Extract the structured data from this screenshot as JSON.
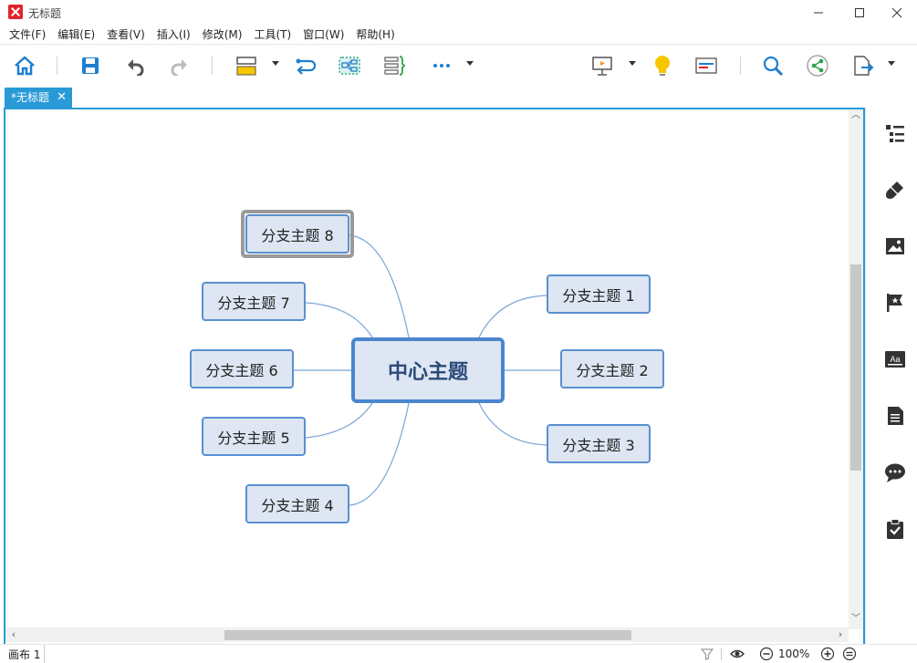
{
  "window": {
    "title": "无标题",
    "minimize": "—",
    "maximize": "☐",
    "close": "✕"
  },
  "menu": [
    "文件(F)",
    "编辑(E)",
    "查看(V)",
    "插入(I)",
    "修改(M)",
    "工具(T)",
    "窗口(W)",
    "帮助(H)"
  ],
  "toolbar": {
    "icons": [
      "home-icon",
      "save-icon",
      "undo-icon",
      "redo-icon",
      "topic-icon",
      "relationship-icon",
      "boundary-icon",
      "summary-icon",
      "more-icon",
      "presentation-icon",
      "idea-icon",
      "gantt-icon",
      "search-icon",
      "share-icon",
      "export-icon"
    ]
  },
  "tab": {
    "label": "*无标题",
    "close": "✕"
  },
  "mindmap": {
    "central": "中心主题",
    "branches": {
      "b1": "分支主题 1",
      "b2": "分支主题 2",
      "b3": "分支主题 3",
      "b4": "分支主题 4",
      "b5": "分支主题 5",
      "b6": "分支主题 6",
      "b7": "分支主题 7",
      "b8": "分支主题 8"
    },
    "selected": "分支主题 8",
    "line_color": "#7aa5d8",
    "topic_fill": "#dde6f2",
    "topic_border": "#5b8fd0"
  },
  "sidebar": {
    "icons": [
      "outline-icon",
      "format-icon",
      "image-icon",
      "marker-icon",
      "text-style-icon",
      "notes-icon",
      "comments-icon",
      "task-icon"
    ]
  },
  "status": {
    "sheet": "画布 1",
    "zoom": "100%"
  },
  "colors": {
    "accent": "#2a9ad7",
    "title_logo": "#e0252a"
  }
}
